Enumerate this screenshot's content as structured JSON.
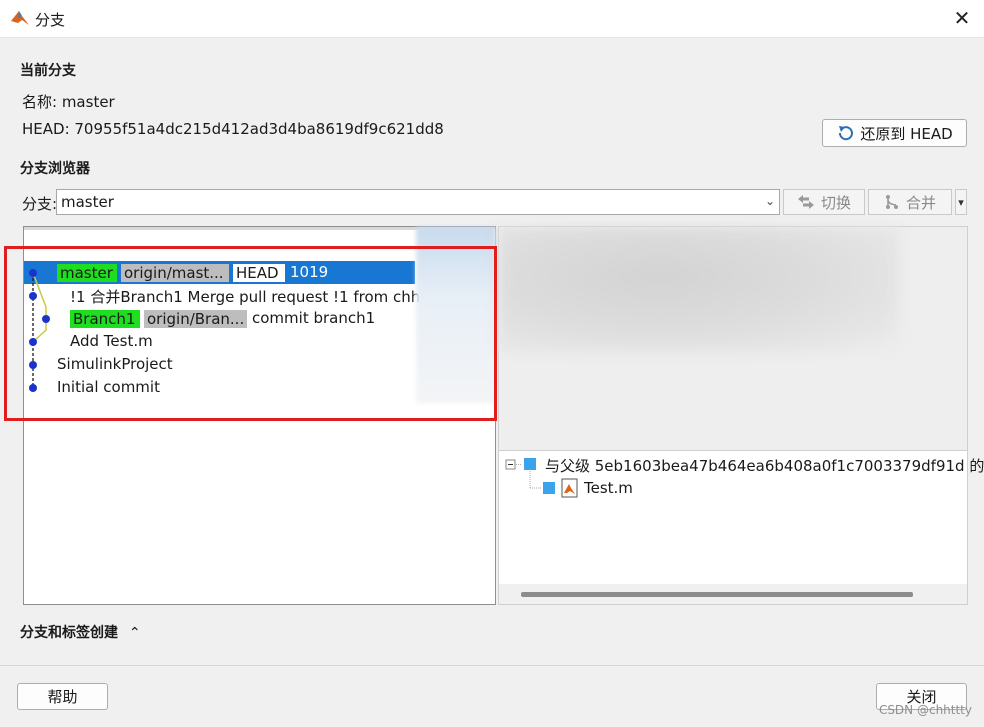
{
  "window": {
    "title": "分支"
  },
  "current_branch": {
    "section_title": "当前分支",
    "name_label": "名称: master",
    "head_label": "HEAD: 70955f51a4dc215d412ad3d4ba8619df9c621dd8",
    "revert_button": "还原到 HEAD"
  },
  "browser": {
    "section_title": "分支浏览器",
    "branch_label": "分支:",
    "branch_value": "master",
    "switch_button": "切换",
    "merge_button": "合并"
  },
  "graph": {
    "rows": [
      {
        "tags": [
          "master",
          "origin/mast...",
          "HEAD"
        ],
        "text": "1019"
      },
      {
        "text": "!1 合并Branch1 Merge pull request !1 from chht"
      },
      {
        "tags": [
          "Branch1",
          "origin/Bran..."
        ],
        "text": "commit branch1"
      },
      {
        "text": "Add Test.m"
      },
      {
        "text": "SimulinkProject"
      },
      {
        "text": "Initial commit"
      }
    ]
  },
  "tree": {
    "root": "与父级 5eb1603bea47b464ea6b408a0f1c7003379df91d 的",
    "child": "Test.m"
  },
  "create_section": {
    "title": "分支和标签创建"
  },
  "footer": {
    "help": "帮助",
    "close": "关闭",
    "watermark": "CSDN @chhttty"
  },
  "colors": {
    "selection": "#1877d2",
    "local_tag": "#1fde1f",
    "remote_tag": "#bdbdbd",
    "highlight_box": "#e01e1e",
    "node": "#1a33cc"
  }
}
